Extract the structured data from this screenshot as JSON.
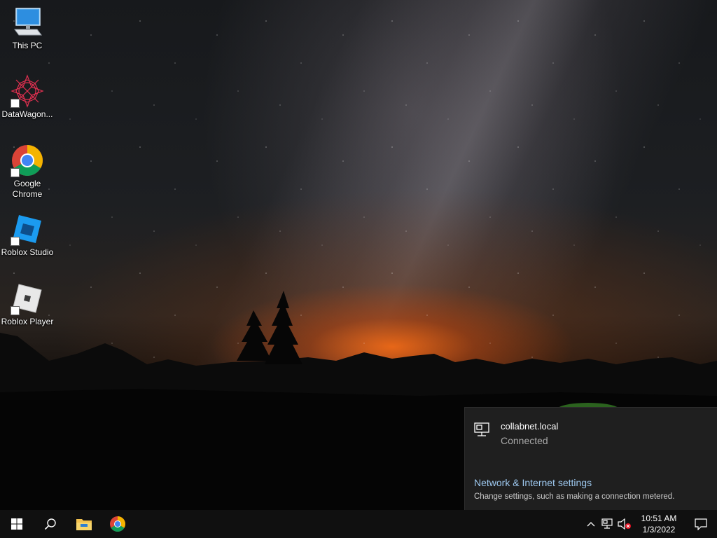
{
  "desktop": {
    "icons": [
      {
        "label": "This PC",
        "icon": "this-pc-icon"
      },
      {
        "label": "DataWagon...",
        "icon": "datawagon-icon"
      },
      {
        "label": "Google Chrome",
        "icon": "chrome-icon"
      },
      {
        "label": "Roblox Studio",
        "icon": "roblox-studio-icon"
      },
      {
        "label": "Roblox Player",
        "icon": "roblox-player-icon"
      }
    ]
  },
  "network_flyout": {
    "network_name": "collabnet.local",
    "status": "Connected",
    "settings_link": "Network & Internet settings",
    "settings_description": "Change settings, such as making a connection metered."
  },
  "taskbar": {
    "start_icon": "windows-logo-icon",
    "search_icon": "search-icon",
    "pinned": [
      "file-explorer-icon",
      "chrome-icon"
    ],
    "tray": {
      "overflow_icon": "chevron-up-icon",
      "network_icon": "network-icon",
      "volume_icon": "volume-muted-icon",
      "time": "10:51 AM",
      "date": "1/3/2022",
      "notification_icon": "action-center-icon"
    }
  },
  "colors": {
    "taskbar_bg": "#101010",
    "flyout_bg": "#1f1f1f",
    "link": "#9ec9f0",
    "muted_text": "#a8a8a8"
  }
}
